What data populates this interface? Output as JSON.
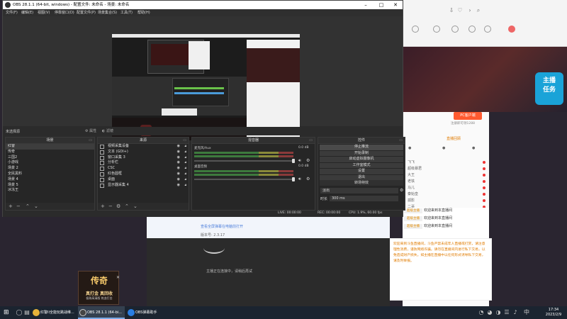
{
  "obs": {
    "title": "OBS 28.1.1 (64-bit, windows) - 配置文件: 未命名 - 场景: 未命名",
    "menu": [
      "文件(F)",
      "编辑(E)",
      "视图(V)",
      "停靠窗口(D)",
      "配置文件(P)",
      "场景集合(S)",
      "工具(T)",
      "帮助(H)"
    ],
    "status_no_source": "未选择源",
    "prop_btn": "属性",
    "filter_btn": "滤镜",
    "docks": {
      "scenes_title": "场景",
      "sources_title": "来源",
      "mixer_title": "混音器",
      "controls_title": "控件"
    },
    "scenes": [
      "红警",
      "传奇",
      "三国2",
      "小游戏",
      "场景 2",
      "全民黑料",
      "场景 4",
      "场景 5",
      "冰冻王"
    ],
    "sources": [
      "视频采集设备",
      "文本 (GDI+)",
      "窗口采集 3",
      "分析栏",
      "CSC",
      "红色圆框",
      "桌面",
      "显示器采集 4"
    ],
    "mixer": {
      "track1_label": "麦克风/Aux",
      "track1_db": "0.0 dB",
      "track2_label": "桌面音频",
      "track2_db": "0.0 dB"
    },
    "controls": [
      "停止推流",
      "开始录制",
      "启动虚拟摄像机",
      "工作室模式",
      "设置",
      "退出"
    ],
    "transition_label": "转场特效",
    "transition_value": "淡出",
    "duration_label": "时长",
    "duration_value": "300 ms",
    "status_bar": {
      "live": "LIVE: 00:00:00",
      "rec": "REC: 00:00:00",
      "cpu": "CPU: 1.9%, 60.00 fps"
    }
  },
  "helper": {
    "hint": "查看全屏弹幕在电脑前打开",
    "version": "版本号: 2.3.17",
    "status": "主播正在连接中，请稍后再试"
  },
  "ad": {
    "logo": "传奇",
    "slogan": "真打金  真回收",
    "sub": "极致高清版 热血打金"
  },
  "browser": {
    "pc_button": "PC客户端",
    "register": "注册即可领1288",
    "tab_active": "直播回顾",
    "chat_rows": [
      "飞飞",
      "超级暴君",
      "大王",
      "老铁",
      "马儿",
      "秦始皇",
      "孤影",
      "二哥"
    ],
    "welcome": [
      {
        "badge": "超级主播",
        "text": "欢迎来到本直播间"
      },
      {
        "badge": "超级主播",
        "text": "欢迎来到本直播间"
      },
      {
        "badge": "超级主播",
        "text": "欢迎来到本直播间"
      }
    ],
    "notice": "欢迎来到斗鱼直播间，斗鱼严禁未成年人直播或打赏，请注意理性消费，谨防网络诈骗。请勿在直播间内进行私下交易，以免造成财产损失。如主播在直播中以任何形式诱导私下交易，请及时举报。"
  },
  "taskbar": {
    "apps": [
      "红警II全能玩跳战维...",
      "OBS 28.1.1 (64-bi...",
      "OBS弹幕助手"
    ],
    "time": "17:34",
    "date": "2023/2/9"
  }
}
